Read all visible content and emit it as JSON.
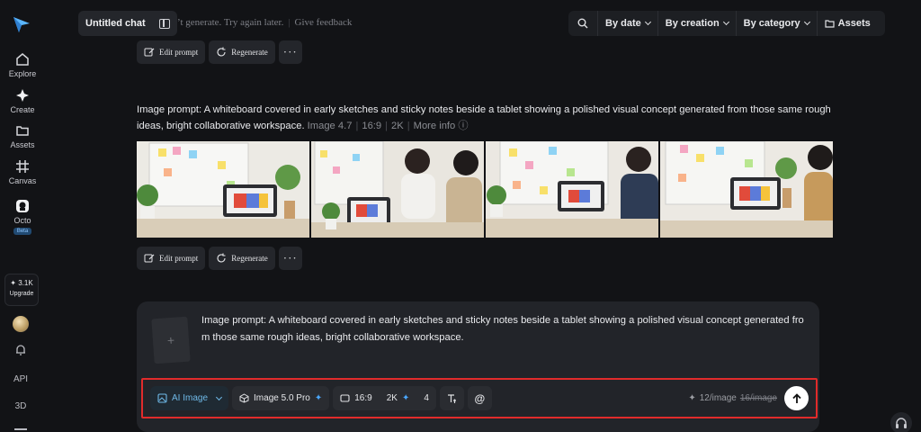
{
  "top": {
    "chat_title": "Untitled chat",
    "error_partial": "’t generate. Try again later.",
    "feedback_link": "Give feedback"
  },
  "filters": {
    "by_date": "By date",
    "by_creation": "By creation",
    "by_category": "By category",
    "assets": "Assets"
  },
  "sidebar": {
    "items": [
      {
        "label": "Explore",
        "icon": "home-icon"
      },
      {
        "label": "Create",
        "icon": "sparkle-icon"
      },
      {
        "label": "Assets",
        "icon": "folder-icon"
      },
      {
        "label": "Canvas",
        "icon": "canvas-icon"
      },
      {
        "label": "Octo",
        "icon": "octo-icon",
        "badge": "Beta"
      }
    ],
    "credits": "3.1K",
    "upgrade_label": "Upgrade",
    "api_label": "API",
    "three_d_label": "3D"
  },
  "actions": {
    "edit_prompt": "Edit prompt",
    "regenerate": "Regenerate",
    "more": "···"
  },
  "result": {
    "prompt_text": "Image prompt: A whiteboard covered in early sketches and sticky notes beside a tablet showing a polished visual concept generated from those same rough ideas, bright collaborative workspace.",
    "model": "Image 4.7",
    "ratio": "16:9",
    "resolution": "2K",
    "more_info": "More info"
  },
  "composer": {
    "prompt_text": "Image prompt: A whiteboard covered in early sketches and sticky notes beside a tablet showing a polished visual concept generated fro m those same rough ideas, bright collaborative workspace.",
    "add_symbol": "+",
    "mode_label": "AI Image",
    "model_label": "Image 5.0 Pro",
    "ratio_label": "16:9",
    "resolution_label": "2K",
    "count_label": "4",
    "cost_label": "12/image",
    "cost_original": "16/image"
  },
  "colors": {
    "background": "#121316",
    "panel": "#222429",
    "accent_blue": "#4aa8ff",
    "highlight_red": "#e12b2b"
  }
}
